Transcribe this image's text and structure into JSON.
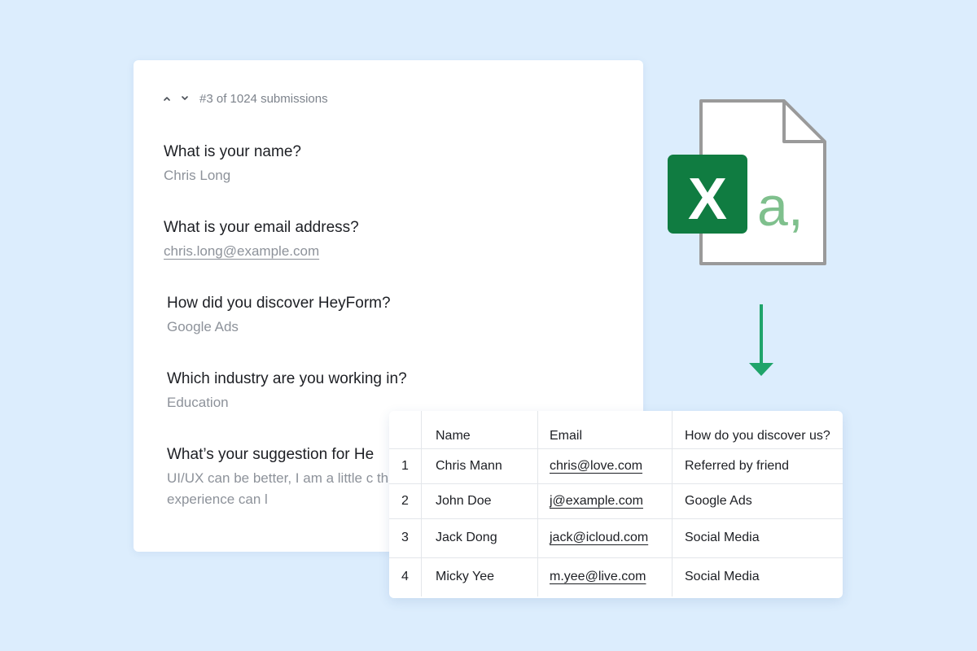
{
  "submission_nav": {
    "counter": "#3 of 1024 submissions"
  },
  "questions": [
    {
      "label": "What is your name?",
      "answer": "Chris Long"
    },
    {
      "label": "What is your email address?",
      "answer": "chris.long@example.com"
    },
    {
      "label": "How did you discover HeyForm?",
      "answer": "Google Ads"
    },
    {
      "label": "Which industry are you working in?",
      "answer": "Education"
    },
    {
      "label": "What’s your suggestion for He",
      "answer": "UI/UX can be better, I am a little c that onboarding experience can l"
    }
  ],
  "export_icon": {
    "badge_letter": "X",
    "file_glyph": "a,",
    "colors": {
      "badge": "#107c41",
      "glyph": "#7fc08d",
      "outline": "#9a9a9a",
      "arrow": "#1fa46a"
    }
  },
  "table": {
    "headers": [
      "",
      "Name",
      "Email",
      "How do you discover us?"
    ],
    "rows": [
      {
        "num": "1",
        "name": "Chris Mann",
        "email": "chris@love.com",
        "source": "Referred by friend"
      },
      {
        "num": "2",
        "name": "John Doe",
        "email": "j@example.com",
        "source": "Google Ads"
      },
      {
        "num": "3",
        "name": "Jack Dong",
        "email": "jack@icloud.com",
        "source": "Social Media"
      },
      {
        "num": "4",
        "name": "Micky Yee",
        "email": "m.yee@live.com",
        "source": "Social Media"
      }
    ]
  }
}
